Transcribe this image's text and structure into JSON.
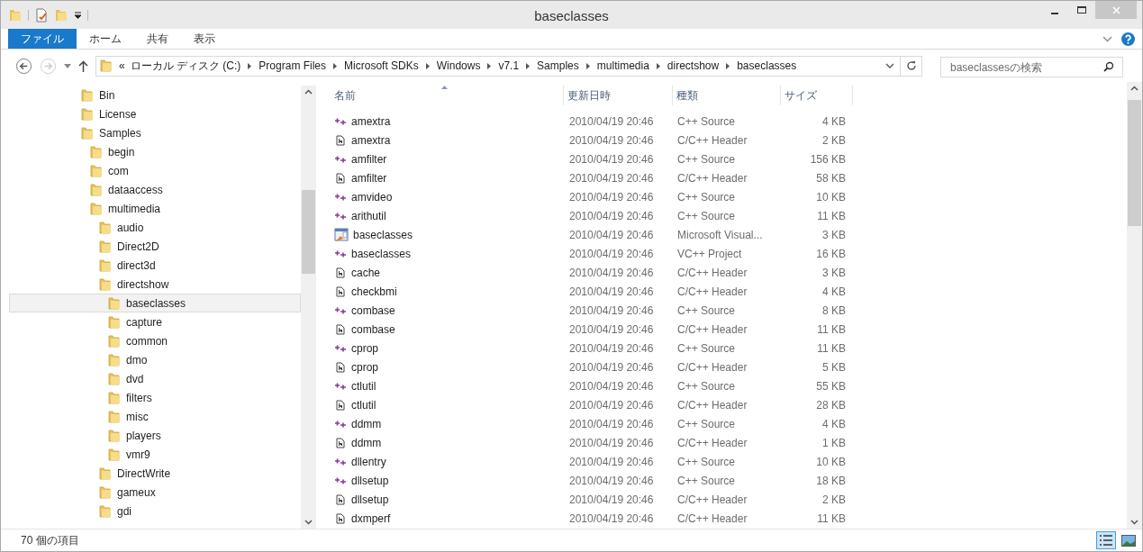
{
  "window": {
    "title": "baseclasses"
  },
  "ribbon_tabs": [
    {
      "label": "ファイル",
      "selected": true
    },
    {
      "label": "ホーム",
      "selected": false
    },
    {
      "label": "共有",
      "selected": false
    },
    {
      "label": "表示",
      "selected": false
    }
  ],
  "address": {
    "overflow": "«",
    "crumbs": [
      "ローカル ディスク (C:)",
      "Program Files",
      "Microsoft SDKs",
      "Windows",
      "v7.1",
      "Samples",
      "multimedia",
      "directshow",
      "baseclasses"
    ]
  },
  "search": {
    "placeholder": "baseclassesの検索"
  },
  "tree": [
    {
      "label": "Bin",
      "selected": false
    },
    {
      "label": "License",
      "selected": false
    },
    {
      "label": "Samples",
      "selected": false,
      "children": [
        {
          "label": "begin",
          "selected": false
        },
        {
          "label": "com",
          "selected": false
        },
        {
          "label": "dataaccess",
          "selected": false
        },
        {
          "label": "multimedia",
          "selected": false,
          "children": [
            {
              "label": "audio",
              "selected": false
            },
            {
              "label": "Direct2D",
              "selected": false
            },
            {
              "label": "direct3d",
              "selected": false
            },
            {
              "label": "directshow",
              "selected": false,
              "children": [
                {
                  "label": "baseclasses",
                  "selected": true
                },
                {
                  "label": "capture",
                  "selected": false
                },
                {
                  "label": "common",
                  "selected": false
                },
                {
                  "label": "dmo",
                  "selected": false
                },
                {
                  "label": "dvd",
                  "selected": false
                },
                {
                  "label": "filters",
                  "selected": false
                },
                {
                  "label": "misc",
                  "selected": false
                },
                {
                  "label": "players",
                  "selected": false
                },
                {
                  "label": "vmr9",
                  "selected": false
                }
              ]
            },
            {
              "label": "DirectWrite",
              "selected": false
            },
            {
              "label": "gameux",
              "selected": false
            },
            {
              "label": "gdi",
              "selected": false
            }
          ]
        }
      ]
    }
  ],
  "columns": [
    "名前",
    "更新日時",
    "種類",
    "サイズ"
  ],
  "files": [
    {
      "kind": "source",
      "name": "amextra",
      "date": "2010/04/19 20:46",
      "type": "C++ Source",
      "size": "4 KB"
    },
    {
      "kind": "header",
      "name": "amextra",
      "date": "2010/04/19 20:46",
      "type": "C/C++ Header",
      "size": "2 KB"
    },
    {
      "kind": "source",
      "name": "amfilter",
      "date": "2010/04/19 20:46",
      "type": "C++ Source",
      "size": "156 KB"
    },
    {
      "kind": "header",
      "name": "amfilter",
      "date": "2010/04/19 20:46",
      "type": "C/C++ Header",
      "size": "58 KB"
    },
    {
      "kind": "source",
      "name": "amvideo",
      "date": "2010/04/19 20:46",
      "type": "C++ Source",
      "size": "10 KB"
    },
    {
      "kind": "source",
      "name": "arithutil",
      "date": "2010/04/19 20:46",
      "type": "C++ Source",
      "size": "11 KB"
    },
    {
      "kind": "solution",
      "name": "baseclasses",
      "date": "2010/04/19 20:46",
      "type": "Microsoft Visual...",
      "size": "3 KB"
    },
    {
      "kind": "source",
      "name": "baseclasses",
      "date": "2010/04/19 20:46",
      "type": "VC++ Project",
      "size": "16 KB"
    },
    {
      "kind": "header",
      "name": "cache",
      "date": "2010/04/19 20:46",
      "type": "C/C++ Header",
      "size": "3 KB"
    },
    {
      "kind": "header",
      "name": "checkbmi",
      "date": "2010/04/19 20:46",
      "type": "C/C++ Header",
      "size": "4 KB"
    },
    {
      "kind": "source",
      "name": "combase",
      "date": "2010/04/19 20:46",
      "type": "C++ Source",
      "size": "8 KB"
    },
    {
      "kind": "header",
      "name": "combase",
      "date": "2010/04/19 20:46",
      "type": "C/C++ Header",
      "size": "11 KB"
    },
    {
      "kind": "source",
      "name": "cprop",
      "date": "2010/04/19 20:46",
      "type": "C++ Source",
      "size": "11 KB"
    },
    {
      "kind": "header",
      "name": "cprop",
      "date": "2010/04/19 20:46",
      "type": "C/C++ Header",
      "size": "5 KB"
    },
    {
      "kind": "source",
      "name": "ctlutil",
      "date": "2010/04/19 20:46",
      "type": "C++ Source",
      "size": "55 KB"
    },
    {
      "kind": "header",
      "name": "ctlutil",
      "date": "2010/04/19 20:46",
      "type": "C/C++ Header",
      "size": "28 KB"
    },
    {
      "kind": "source",
      "name": "ddmm",
      "date": "2010/04/19 20:46",
      "type": "C++ Source",
      "size": "4 KB"
    },
    {
      "kind": "header",
      "name": "ddmm",
      "date": "2010/04/19 20:46",
      "type": "C/C++ Header",
      "size": "1 KB"
    },
    {
      "kind": "source",
      "name": "dllentry",
      "date": "2010/04/19 20:46",
      "type": "C++ Source",
      "size": "10 KB"
    },
    {
      "kind": "source",
      "name": "dllsetup",
      "date": "2010/04/19 20:46",
      "type": "C++ Source",
      "size": "18 KB"
    },
    {
      "kind": "header",
      "name": "dllsetup",
      "date": "2010/04/19 20:46",
      "type": "C/C++ Header",
      "size": "2 KB"
    },
    {
      "kind": "header",
      "name": "dxmperf",
      "date": "2010/04/19 20:46",
      "type": "C/C++ Header",
      "size": "11 KB"
    }
  ],
  "status_bar": {
    "count": "70 個の項目"
  },
  "views": [
    {
      "kind": "details",
      "selected": true
    },
    {
      "kind": "thumbnails",
      "selected": false
    }
  ]
}
